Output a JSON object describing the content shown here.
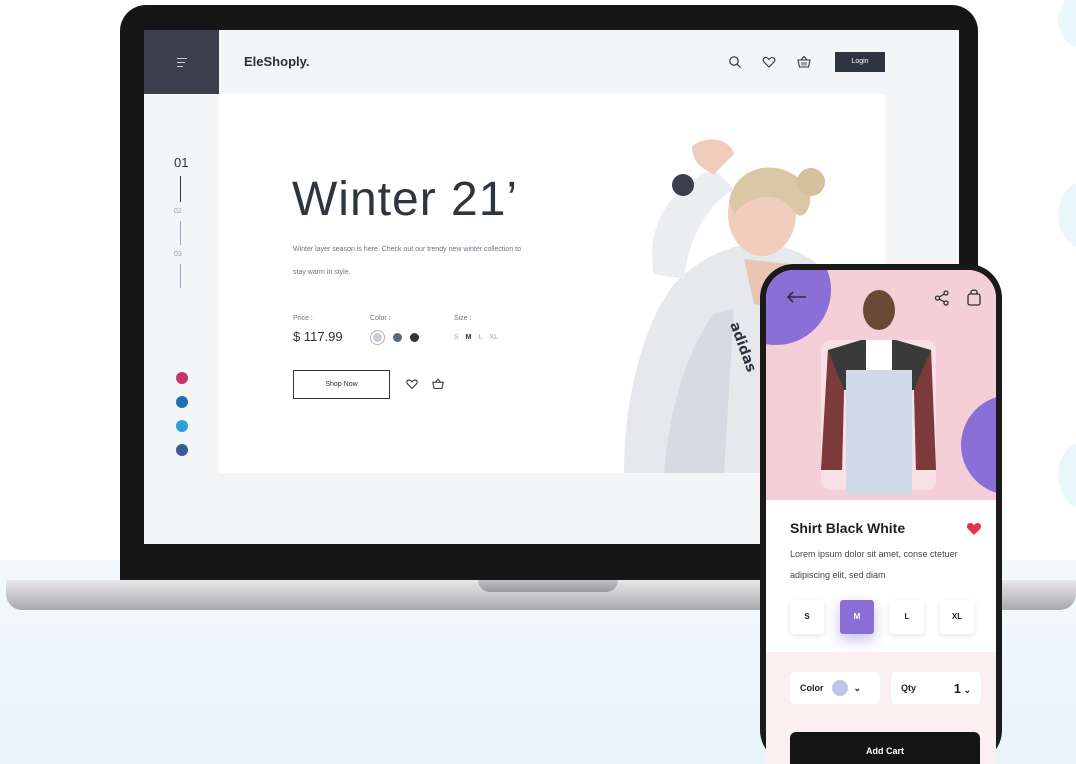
{
  "laptop": {
    "brand": "EleShoply.",
    "login_label": "Login",
    "slides": {
      "active": "01",
      "second": "02",
      "third": "03"
    },
    "hero": {
      "headline": "Winter 21’",
      "subtext": "Winter layer season is here. Check out our trendy new winter collection to stay warm in style.",
      "price_label": "Price :",
      "price_value": "$ 117.99",
      "color_label": "Color :",
      "size_label": "Size :",
      "sizes": [
        "S",
        "M",
        "L",
        "XL"
      ],
      "shop_label": "Shop Now"
    },
    "social": [
      "instagram",
      "linkedin",
      "twitter",
      "facebook"
    ],
    "colors": {
      "sidebar": "#3a3f4b",
      "swatches": [
        "#c9ced9",
        "#5d6781",
        "#2f3441"
      ],
      "instagram": "#c2366c",
      "linkedin": "#1f6fb2",
      "twitter": "#2f9ee0",
      "facebook": "#3b5998"
    }
  },
  "phone": {
    "product_title": "Shirt Black White",
    "description": "Lorem ipsum dolor sit amet, conse ctetuer adipiscing elit, sed diam",
    "sizes": [
      "S",
      "M",
      "L",
      "XL"
    ],
    "selected_size": "M",
    "color_label": "Color",
    "qty_label": "Qty",
    "qty_value": "1",
    "add_cart_label": "Add Cart",
    "colors": {
      "accent": "#8a70d6",
      "heart": "#e0364f",
      "hero_bg": "#f4cfd8"
    }
  }
}
